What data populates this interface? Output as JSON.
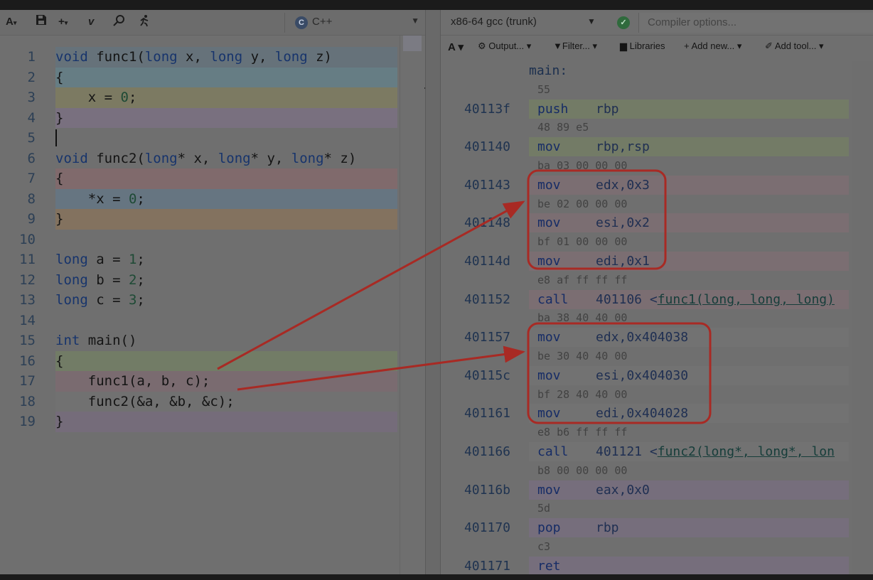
{
  "editor": {
    "toolbar": {
      "font_label": "A",
      "save_icon": "save-icon",
      "add_label": "+",
      "vim_label": "v",
      "search_icon": "search-icon",
      "run_icon": "runner-icon"
    },
    "language": {
      "label": "C++",
      "logo_label": "C"
    },
    "lines": [
      {
        "n": "1",
        "tokens": [
          [
            "kw",
            "void"
          ],
          [
            "t",
            " func1("
          ],
          [
            "kw",
            "long"
          ],
          [
            "t",
            " x, "
          ],
          [
            "kw",
            "long"
          ],
          [
            "t",
            " y, "
          ],
          [
            "kw",
            "long"
          ],
          [
            "t",
            " z)"
          ]
        ]
      },
      {
        "n": "2",
        "tokens": [
          [
            "t",
            "{"
          ]
        ]
      },
      {
        "n": "3",
        "tokens": [
          [
            "t",
            "    x = "
          ],
          [
            "num",
            "0"
          ],
          [
            "t",
            ";"
          ]
        ]
      },
      {
        "n": "4",
        "tokens": [
          [
            "t",
            "}"
          ]
        ]
      },
      {
        "n": "5",
        "tokens": []
      },
      {
        "n": "6",
        "tokens": [
          [
            "kw",
            "void"
          ],
          [
            "t",
            " func2("
          ],
          [
            "kw",
            "long"
          ],
          [
            "t",
            "* x, "
          ],
          [
            "kw",
            "long"
          ],
          [
            "t",
            "* y, "
          ],
          [
            "kw",
            "long"
          ],
          [
            "t",
            "* z)"
          ]
        ]
      },
      {
        "n": "7",
        "tokens": [
          [
            "t",
            "{"
          ]
        ]
      },
      {
        "n": "8",
        "tokens": [
          [
            "t",
            "    *x = "
          ],
          [
            "num",
            "0"
          ],
          [
            "t",
            ";"
          ]
        ]
      },
      {
        "n": "9",
        "tokens": [
          [
            "t",
            "}"
          ]
        ]
      },
      {
        "n": "10",
        "tokens": []
      },
      {
        "n": "11",
        "tokens": [
          [
            "kw",
            "long"
          ],
          [
            "t",
            " a = "
          ],
          [
            "num",
            "1"
          ],
          [
            "t",
            ";"
          ]
        ]
      },
      {
        "n": "12",
        "tokens": [
          [
            "kw",
            "long"
          ],
          [
            "t",
            " b = "
          ],
          [
            "num",
            "2"
          ],
          [
            "t",
            ";"
          ]
        ]
      },
      {
        "n": "13",
        "tokens": [
          [
            "kw",
            "long"
          ],
          [
            "t",
            " c = "
          ],
          [
            "num",
            "3"
          ],
          [
            "t",
            ";"
          ]
        ]
      },
      {
        "n": "14",
        "tokens": []
      },
      {
        "n": "15",
        "tokens": [
          [
            "kw",
            "int"
          ],
          [
            "t",
            " main()"
          ]
        ]
      },
      {
        "n": "16",
        "tokens": [
          [
            "t",
            "{"
          ]
        ]
      },
      {
        "n": "17",
        "tokens": [
          [
            "t",
            "    func1(a, b, c);"
          ]
        ]
      },
      {
        "n": "18",
        "tokens": [
          [
            "t",
            "    func2(&a, &b, &c);"
          ]
        ]
      },
      {
        "n": "19",
        "tokens": [
          [
            "t",
            "}"
          ]
        ]
      }
    ],
    "highlights": [
      {
        "line": 1,
        "color": "#66727a"
      },
      {
        "line": 2,
        "color": "#667d84"
      },
      {
        "line": 3,
        "color": "#7c7a62"
      },
      {
        "line": 4,
        "color": "#79707f"
      },
      {
        "line": 7,
        "color": "#806a6c"
      },
      {
        "line": 8,
        "color": "#667581"
      },
      {
        "line": 9,
        "color": "#83725f"
      },
      {
        "line": 16,
        "color": "#727c66"
      },
      {
        "line": 17,
        "color": "#7a6b70"
      },
      {
        "line": 18,
        "color": "#717171"
      },
      {
        "line": 19,
        "color": "#756c7a"
      }
    ]
  },
  "compiler": {
    "name": "x86-64 gcc (trunk)",
    "options_placeholder": "Compiler options...",
    "status": "ok",
    "tools": {
      "font": "A",
      "output": "Output...",
      "filter": "Filter...",
      "libraries": "Libraries",
      "add_new": "+ Add new...",
      "add_tool": "Add tool..."
    },
    "asm": [
      {
        "kind": "label",
        "text": "main:"
      },
      {
        "kind": "bytes",
        "text": "55"
      },
      {
        "kind": "ins",
        "addr": "40113f",
        "op": "push",
        "args": "rbp",
        "color": "#737b66"
      },
      {
        "kind": "bytes",
        "text": "48 89 e5"
      },
      {
        "kind": "ins",
        "addr": "401140",
        "op": "mov",
        "args": "rbp,rsp",
        "color": "#737b66"
      },
      {
        "kind": "bytes",
        "text": "ba 03 00 00 00"
      },
      {
        "kind": "ins",
        "addr": "401143",
        "op": "mov",
        "args": "edx,0x3",
        "color": "#7b6e72"
      },
      {
        "kind": "bytes",
        "text": "be 02 00 00 00"
      },
      {
        "kind": "ins",
        "addr": "401148",
        "op": "mov",
        "args": "esi,0x2",
        "color": "#7b6e72"
      },
      {
        "kind": "bytes",
        "text": "bf 01 00 00 00"
      },
      {
        "kind": "ins",
        "addr": "40114d",
        "op": "mov",
        "args": "edi,0x1",
        "color": "#7b6e72"
      },
      {
        "kind": "bytes",
        "text": "e8 af ff ff ff"
      },
      {
        "kind": "ins",
        "addr": "401152",
        "op": "call",
        "args": "401106 <",
        "link": "func1(long, long, long)",
        "color": "#7b6e72"
      },
      {
        "kind": "bytes",
        "text": "ba 38 40 40 00"
      },
      {
        "kind": "ins",
        "addr": "401157",
        "op": "mov",
        "args": "edx,0x404038",
        "color": "#727272"
      },
      {
        "kind": "bytes",
        "text": "be 30 40 40 00"
      },
      {
        "kind": "ins",
        "addr": "40115c",
        "op": "mov",
        "args": "esi,0x404030",
        "color": "#727272"
      },
      {
        "kind": "bytes",
        "text": "bf 28 40 40 00"
      },
      {
        "kind": "ins",
        "addr": "401161",
        "op": "mov",
        "args": "edi,0x404028",
        "color": "#727272"
      },
      {
        "kind": "bytes",
        "text": "e8 b6 ff ff ff"
      },
      {
        "kind": "ins",
        "addr": "401166",
        "op": "call",
        "args": "401121 <",
        "link": "func2(long*, long*, lon",
        "color": "#727272"
      },
      {
        "kind": "bytes",
        "text": "b8 00 00 00 00"
      },
      {
        "kind": "ins",
        "addr": "40116b",
        "op": "mov",
        "args": "eax,0x0",
        "color": "#766e7c"
      },
      {
        "kind": "bytes",
        "text": "5d"
      },
      {
        "kind": "ins",
        "addr": "401170",
        "op": "pop",
        "args": "rbp",
        "color": "#766e7c"
      },
      {
        "kind": "bytes",
        "text": "c3"
      },
      {
        "kind": "ins",
        "addr": "401171",
        "op": "ret",
        "args": "",
        "color": "#766e7c"
      }
    ]
  },
  "annotation_color": "#a82a24"
}
